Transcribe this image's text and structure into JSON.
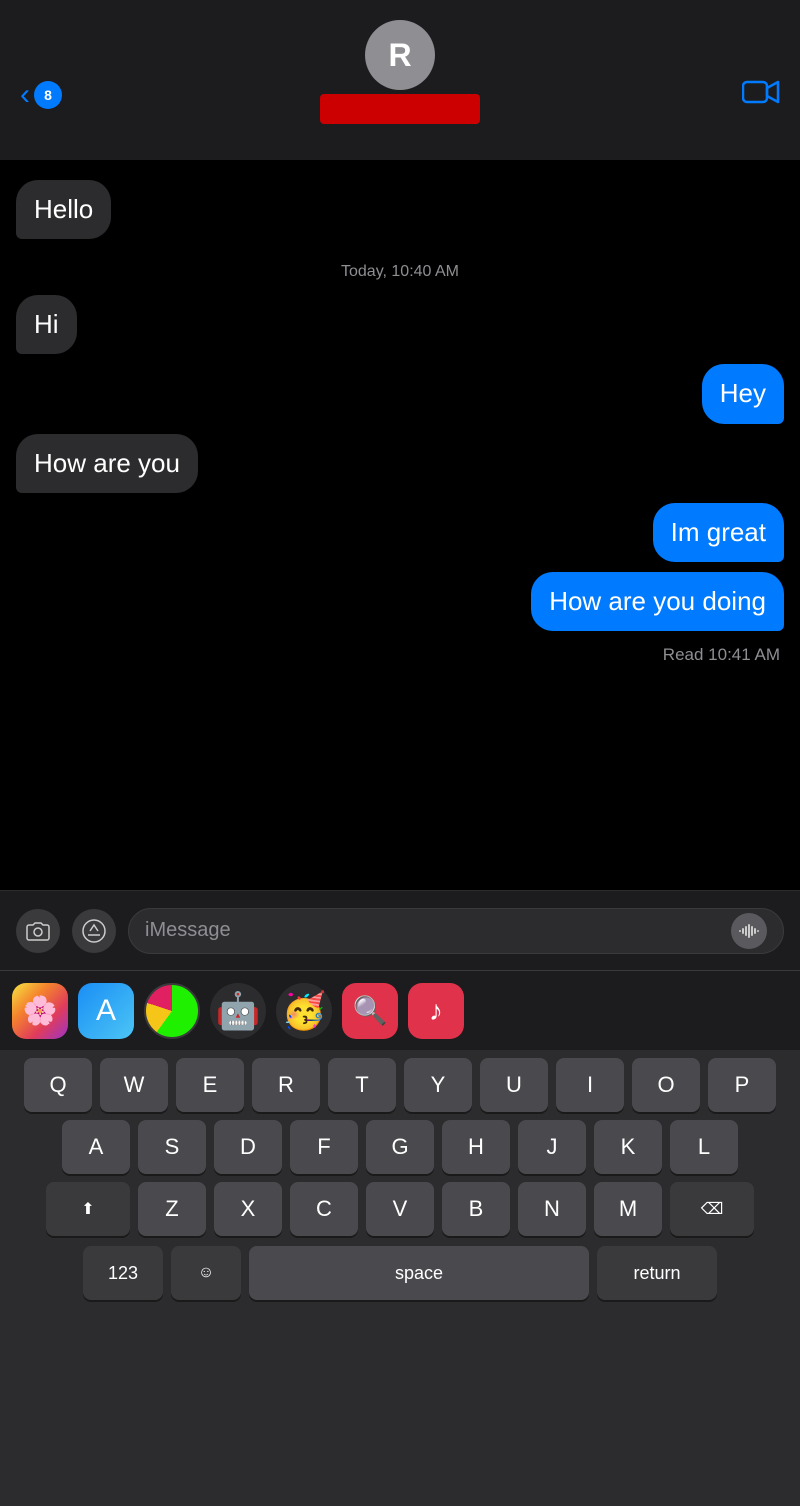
{
  "header": {
    "back_count": "8",
    "avatar_initial": "R",
    "back_chevron": "‹",
    "video_icon": "□"
  },
  "messages": [
    {
      "id": 1,
      "type": "received",
      "text": "Hello"
    },
    {
      "id": 2,
      "timestamp": "Today, 10:40 AM"
    },
    {
      "id": 3,
      "type": "received",
      "text": "Hi"
    },
    {
      "id": 4,
      "type": "sent",
      "text": "Hey"
    },
    {
      "id": 5,
      "type": "received",
      "text": "How are you"
    },
    {
      "id": 6,
      "type": "sent",
      "text": "Im great"
    },
    {
      "id": 7,
      "type": "sent",
      "text": "How are you doing"
    }
  ],
  "read_receipt": "Read 10:41 AM",
  "input": {
    "placeholder": "iMessage"
  },
  "keyboard": {
    "row1": [
      "Q",
      "W",
      "E",
      "R",
      "T",
      "Y",
      "U",
      "I",
      "O",
      "P"
    ],
    "row2": [
      "A",
      "S",
      "D",
      "F",
      "G",
      "H",
      "J",
      "K",
      "L"
    ],
    "row3": [
      "Z",
      "X",
      "C",
      "V",
      "B",
      "N",
      "M"
    ],
    "numbers_label": "123",
    "emoji_label": "☺",
    "space_label": "space",
    "return_label": "return"
  },
  "tray": {
    "icons": [
      "📷",
      "🅐",
      "⊙",
      "🤖",
      "🥳",
      "🔍",
      "♫"
    ]
  }
}
